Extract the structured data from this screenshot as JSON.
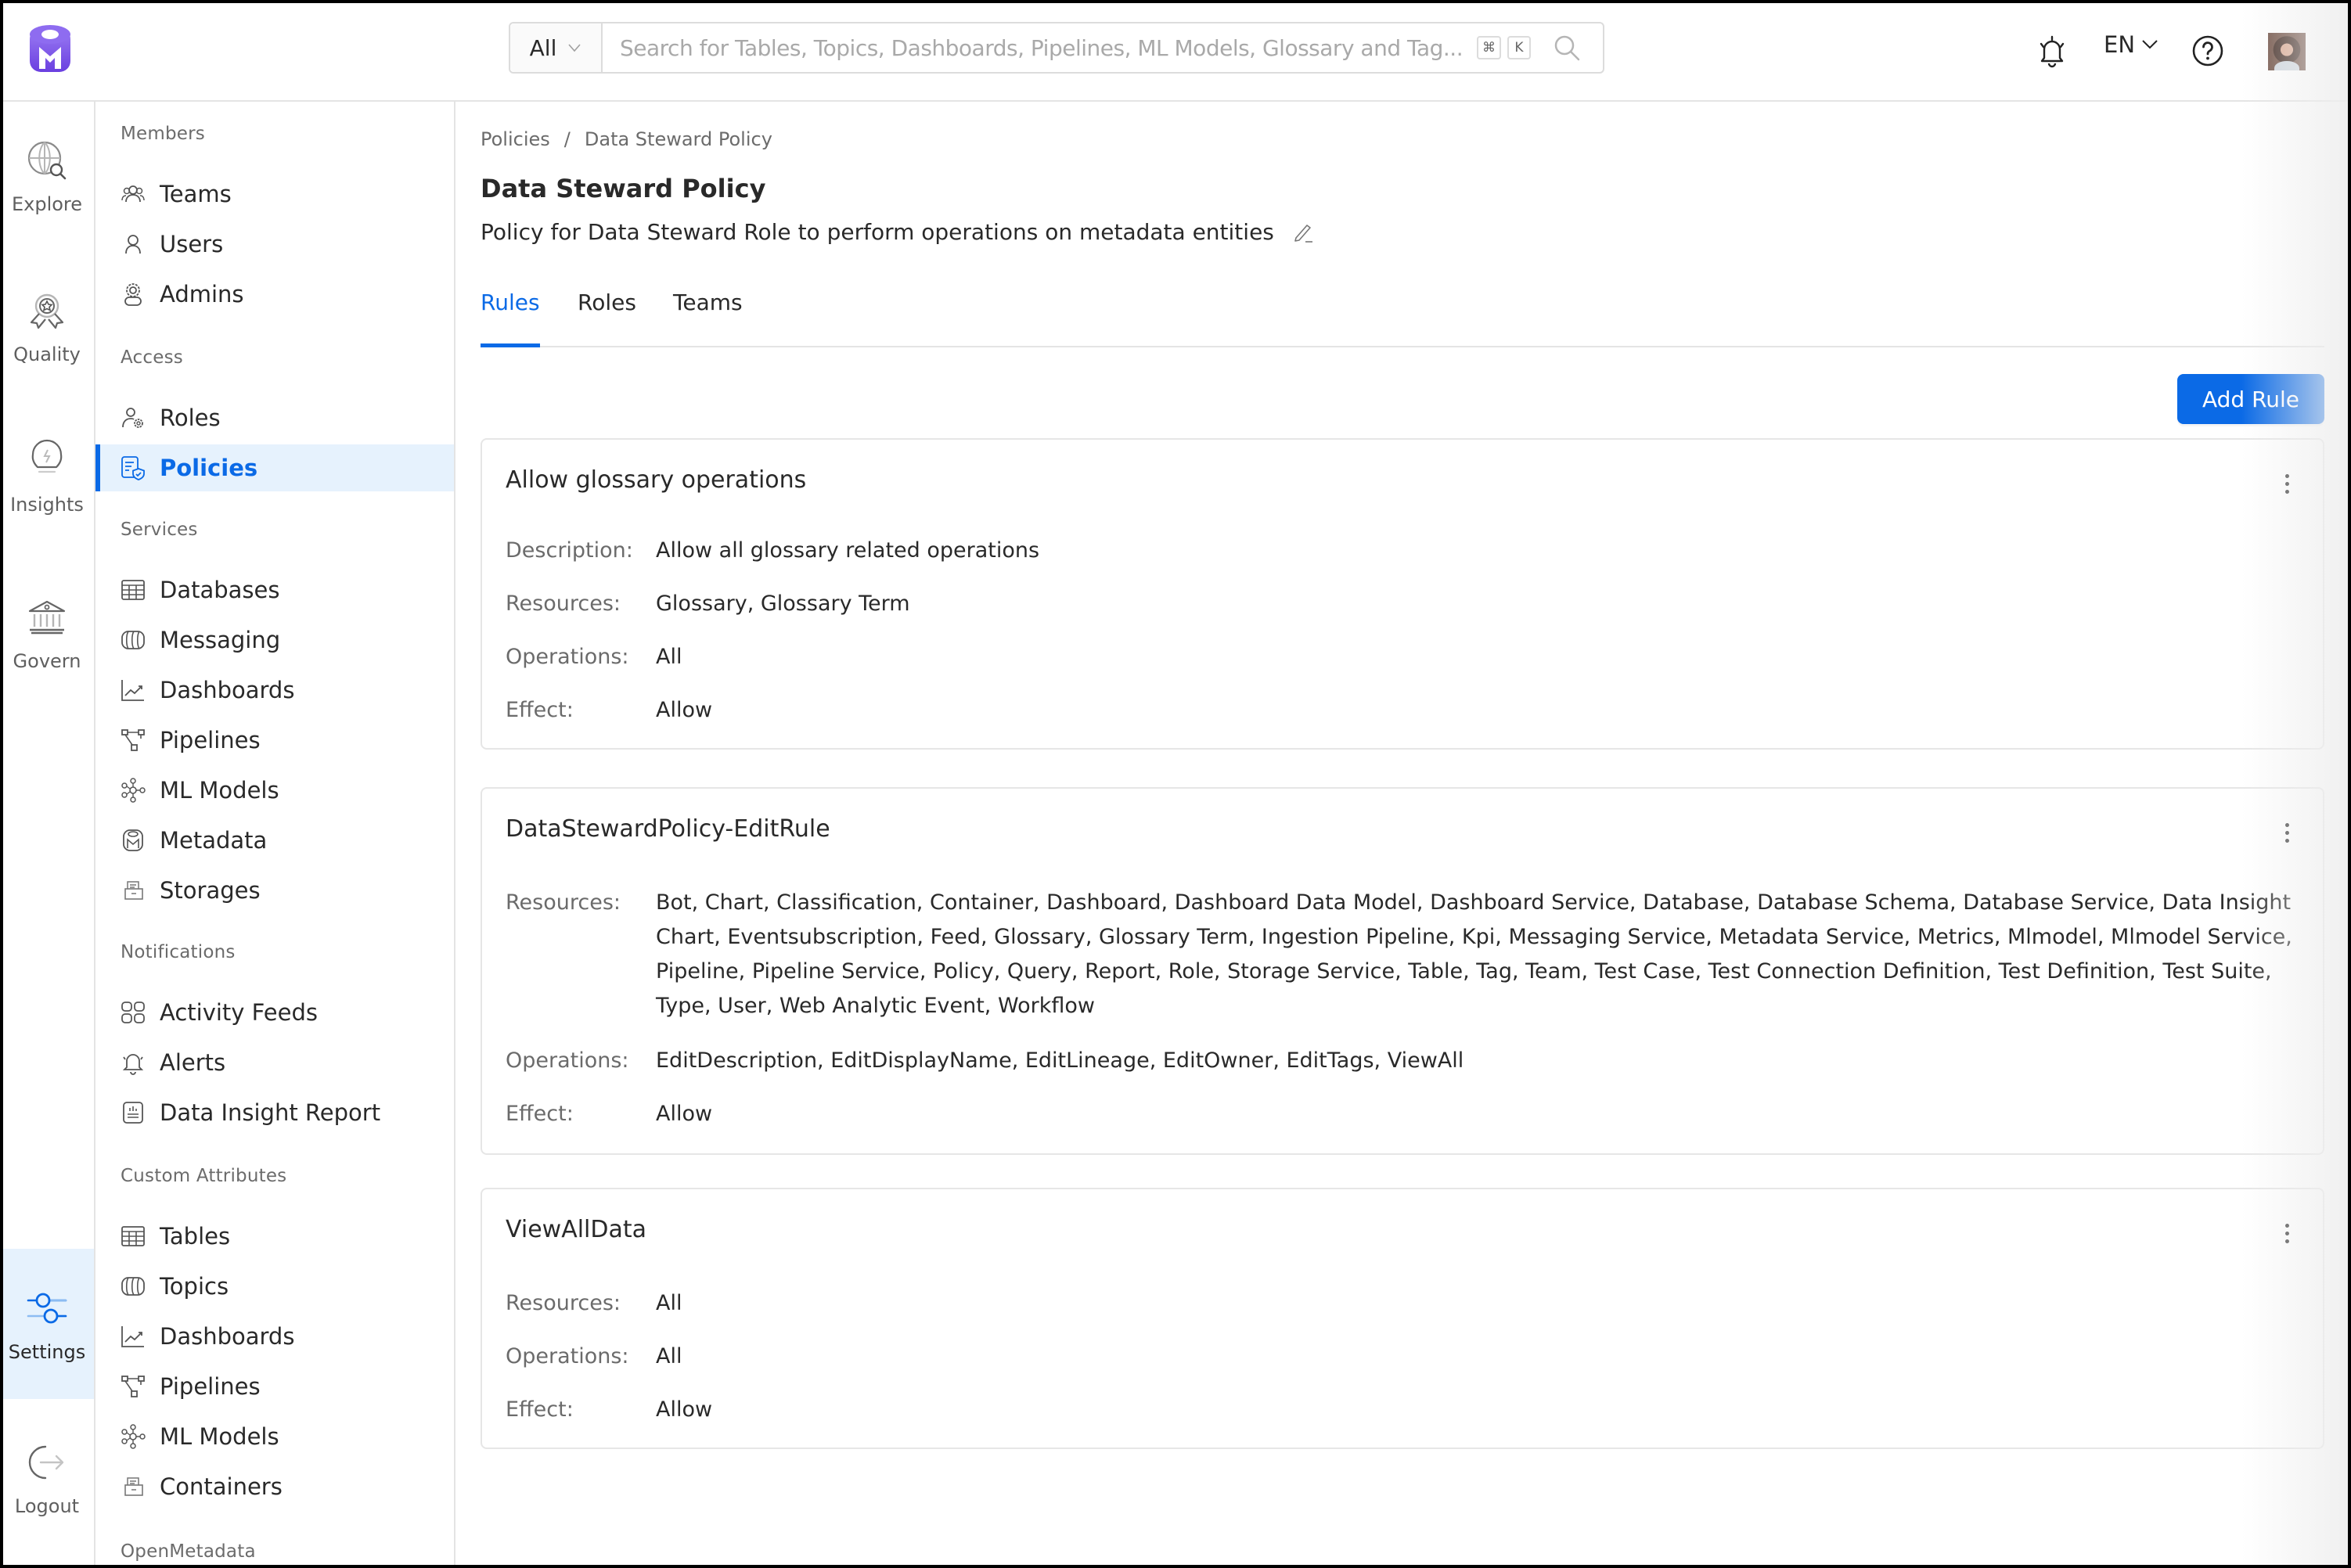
{
  "header": {
    "search_scope": "All",
    "search_placeholder": "Search for Tables, Topics, Dashboards, Pipelines, ML Models, Glossary and Tag...",
    "shortcut_keys": [
      "⌘",
      "K"
    ],
    "language": "EN"
  },
  "rail": {
    "items": [
      {
        "label": "Explore",
        "icon": "globe-search-icon"
      },
      {
        "label": "Quality",
        "icon": "award-icon"
      },
      {
        "label": "Insights",
        "icon": "lightbulb-icon"
      },
      {
        "label": "Govern",
        "icon": "bank-icon"
      },
      {
        "label": "Settings",
        "icon": "sliders-icon",
        "active": true
      },
      {
        "label": "Logout",
        "icon": "logout-icon"
      }
    ]
  },
  "sidebar": {
    "groups": [
      {
        "title": "Members",
        "items": [
          {
            "label": "Teams",
            "icon": "teams-icon"
          },
          {
            "label": "Users",
            "icon": "user-icon"
          },
          {
            "label": "Admins",
            "icon": "admin-icon"
          }
        ]
      },
      {
        "title": "Access",
        "items": [
          {
            "label": "Roles",
            "icon": "roles-icon"
          },
          {
            "label": "Policies",
            "icon": "policy-icon",
            "active": true
          }
        ]
      },
      {
        "title": "Services",
        "items": [
          {
            "label": "Databases",
            "icon": "table-icon"
          },
          {
            "label": "Messaging",
            "icon": "topic-icon"
          },
          {
            "label": "Dashboards",
            "icon": "chart-icon"
          },
          {
            "label": "Pipelines",
            "icon": "pipeline-icon"
          },
          {
            "label": "ML Models",
            "icon": "mlmodel-icon"
          },
          {
            "label": "Metadata",
            "icon": "metadata-icon"
          },
          {
            "label": "Storages",
            "icon": "storage-icon"
          }
        ]
      },
      {
        "title": "Notifications",
        "items": [
          {
            "label": "Activity Feeds",
            "icon": "grid-icon"
          },
          {
            "label": "Alerts",
            "icon": "bell-icon"
          },
          {
            "label": "Data Insight Report",
            "icon": "report-icon"
          }
        ]
      },
      {
        "title": "Custom Attributes",
        "items": [
          {
            "label": "Tables",
            "icon": "table-icon"
          },
          {
            "label": "Topics",
            "icon": "topic-icon"
          },
          {
            "label": "Dashboards",
            "icon": "chart-icon"
          },
          {
            "label": "Pipelines",
            "icon": "pipeline-icon"
          },
          {
            "label": "ML Models",
            "icon": "mlmodel-icon"
          },
          {
            "label": "Containers",
            "icon": "storage-icon"
          }
        ]
      },
      {
        "title": "OpenMetadata",
        "items": []
      }
    ]
  },
  "main": {
    "breadcrumb": [
      "Policies",
      "Data Steward Policy"
    ],
    "breadcrumb_separator": "/",
    "title": "Data Steward Policy",
    "description": "Policy for Data Steward Role to perform operations on metadata entities",
    "tabs": [
      {
        "label": "Rules",
        "active": true
      },
      {
        "label": "Roles"
      },
      {
        "label": "Teams"
      }
    ],
    "add_rule_label": "Add Rule",
    "labels": {
      "description": "Description:",
      "resources": "Resources:",
      "operations": "Operations:",
      "effect": "Effect:"
    },
    "rules": [
      {
        "name": "Allow glossary operations",
        "description": "Allow all glossary related operations",
        "resources": "Glossary, Glossary Term",
        "operations": "All",
        "effect": "Allow"
      },
      {
        "name": "DataStewardPolicy-EditRule",
        "resources": "Bot, Chart, Classification, Container, Dashboard, Dashboard Data Model, Dashboard Service, Database, Database Schema, Database Service, Data Insight Chart, Eventsubscription, Feed, Glossary, Glossary Term, Ingestion Pipeline, Kpi, Messaging Service, Metadata Service, Metrics, Mlmodel, Mlmodel Service, Pipeline, Pipeline Service, Policy, Query, Report, Role, Storage Service, Table, Tag, Team, Test Case, Test Connection Definition, Test Definition, Test Suite, Type, User, Web Analytic Event, Workflow",
        "operations": "EditDescription, EditDisplayName, EditLineage, EditOwner, EditTags, ViewAll",
        "effect": "Allow"
      },
      {
        "name": "ViewAllData",
        "resources": "All",
        "operations": "All",
        "effect": "Allow"
      }
    ]
  },
  "colors": {
    "accent": "#0b6ae6",
    "active_bg": "#e6f2fd",
    "brand_purple": "#7147e8",
    "border": "#e4e4e4",
    "muted_text": "#6b6b6b"
  }
}
